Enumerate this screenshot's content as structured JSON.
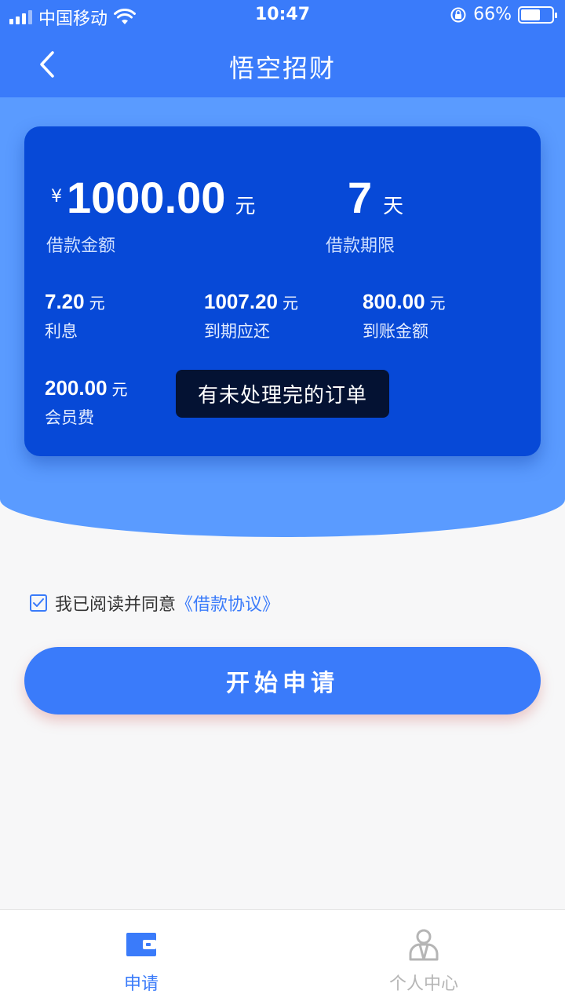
{
  "status_bar": {
    "carrier": "中国移动",
    "time": "10:47",
    "battery_percent_text": "66%",
    "battery_level": 0.66
  },
  "nav": {
    "title": "悟空招财",
    "back_icon": "chevron-left-icon"
  },
  "loan": {
    "currency_symbol": "¥",
    "amount": "1000.00",
    "amount_unit": "元",
    "amount_label": "借款金额",
    "term": "7",
    "term_unit": "天",
    "term_label": "借款期限",
    "stats": [
      {
        "value": "7.20",
        "unit": "元",
        "label": "利息"
      },
      {
        "value": "1007.20",
        "unit": "元",
        "label": "到期应还"
      },
      {
        "value": "800.00",
        "unit": "元",
        "label": "到账金额"
      },
      {
        "value": "200.00",
        "unit": "元",
        "label": "会员费"
      }
    ]
  },
  "toast": {
    "message": "有未处理完的订单"
  },
  "agreement": {
    "text": "我已阅读并同意",
    "link": "《借款协议》",
    "checked": true
  },
  "apply_button": {
    "label": "开始申请"
  },
  "tabs": [
    {
      "label": "申请",
      "icon": "wallet-icon",
      "active": true
    },
    {
      "label": "个人中心",
      "icon": "user-icon",
      "active": false
    }
  ],
  "colors": {
    "primary": "#3a7bfa",
    "hero": "#5a9bff",
    "card": "#0749d7",
    "toast": "#041233"
  }
}
